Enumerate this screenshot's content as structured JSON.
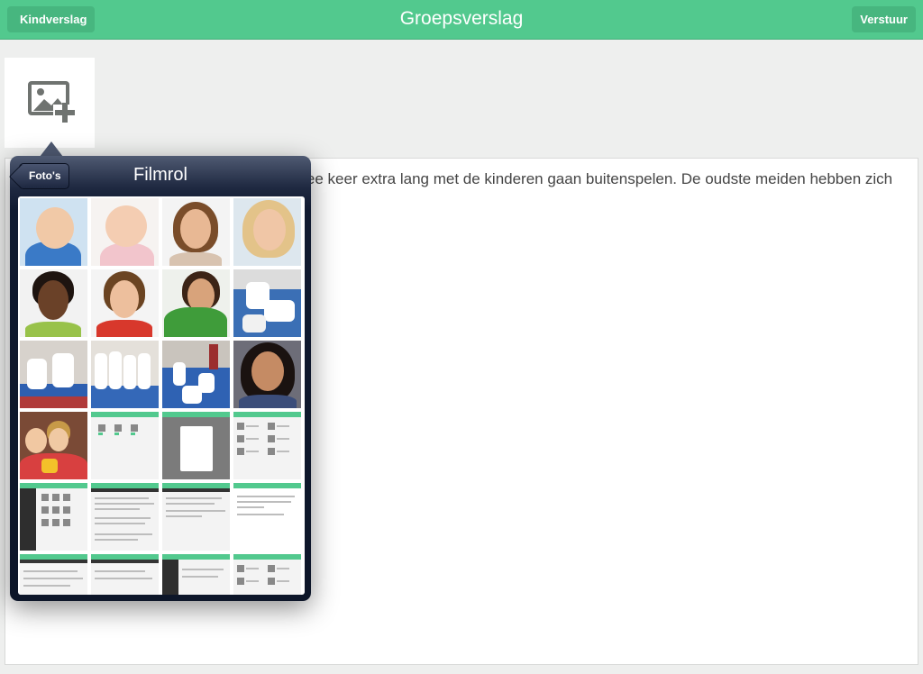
{
  "nav": {
    "back_label": "Kindverslag",
    "title": "Groepsverslag",
    "send_label": "Verstuur"
  },
  "add_photo": {
    "icon": "add-photo-icon"
  },
  "report": {
    "text": "Vandaag was het mooi weer. We zijn twee keer extra lang met de kinderen gaan buitenspelen. De oudste meiden hebben zich verkleed in een judopak."
  },
  "popover": {
    "back_label": "Foto's",
    "title": "Filmrol"
  },
  "colors": {
    "accent": "#52c98e",
    "popover_dark": "#101a30"
  }
}
